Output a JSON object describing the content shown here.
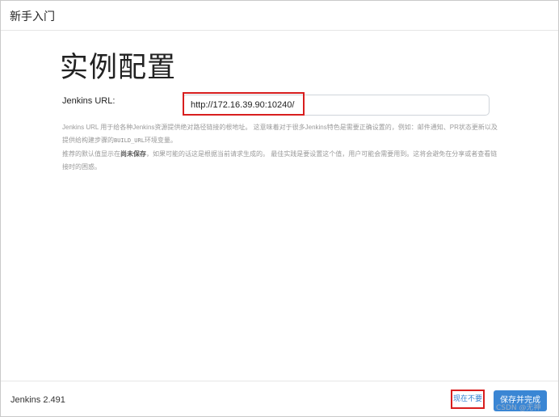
{
  "header": {
    "title": "新手入门"
  },
  "main": {
    "heading": "实例配置",
    "url_label": "Jenkins URL:",
    "url_value": "http://172.16.39.90:10240/",
    "help_p1_a": "Jenkins URL 用于给各种Jenkins资源提供绝对路径链接的根地址。 这意味着对于很多Jenkins特色是需要正确设置的，例如：邮件通知、PR状态更新以及提供给构建步骤的",
    "help_p1_code": "BUILD_URL",
    "help_p1_b": "环境变量。",
    "help_p2_a": "推荐的默认值显示在",
    "help_p2_bold": "尚未保存",
    "help_p2_b": "，如果可能的话这是根据当前请求生成的。 最佳实践是要设置这个值，用户可能会需要用到。这将会避免在分享或者查看链接时的困惑。"
  },
  "footer": {
    "version": "Jenkins 2.491",
    "skip_label": "现在不要",
    "save_label": "保存并完成"
  },
  "watermark": "CSDN @无神",
  "colors": {
    "primary": "#3a86d4",
    "highlight": "#d81e1e",
    "link": "#2f7fd1"
  }
}
